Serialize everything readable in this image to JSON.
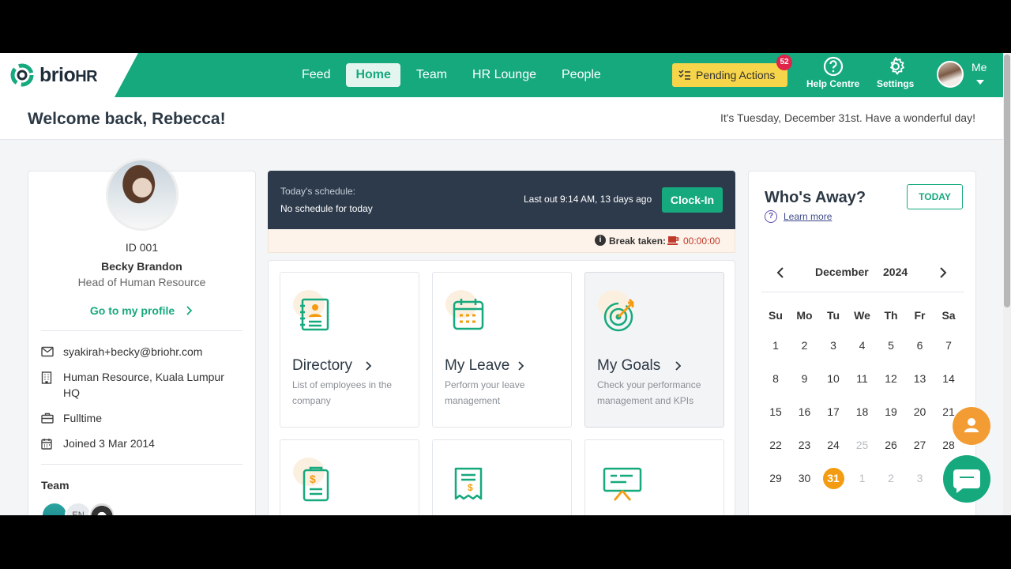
{
  "brand": {
    "name_main": "brio",
    "name_suffix": "HR"
  },
  "nav": {
    "items": [
      "Feed",
      "Home",
      "Team",
      "HR Lounge",
      "People"
    ],
    "active": "Home"
  },
  "header_actions": {
    "pending_label": "Pending Actions",
    "pending_count": "52",
    "help_label": "Help Centre",
    "settings_label": "Settings",
    "me_label": "Me"
  },
  "welcome": {
    "title": "Welcome back, Rebecca!",
    "date_message": "It's Tuesday, December 31st. Have a wonderful day!"
  },
  "profile": {
    "id": "ID 001",
    "name": "Becky Brandon",
    "role": "Head of Human Resource",
    "profile_link": "Go to my profile",
    "email": "syakirah+becky@briohr.com",
    "department": "Human Resource, Kuala Lumpur HQ",
    "employment": "Fulltime",
    "joined": "Joined 3 Mar 2014",
    "team_label": "Team",
    "team_avatar_initials": "EN"
  },
  "schedule": {
    "label": "Today's schedule:",
    "value": "No schedule for today",
    "last_out": "Last out 9:14 AM, 13 days ago",
    "clock_in": "Clock-In",
    "break_label": "Break taken:",
    "break_timer": "00:00:00"
  },
  "tiles": [
    {
      "title": "Directory",
      "desc": "List of employees in the company"
    },
    {
      "title": "My Leave",
      "desc": "Perform your leave management"
    },
    {
      "title": "My Goals",
      "desc": "Check your performance management and KPIs"
    }
  ],
  "away": {
    "title": "Who's Away?",
    "today_btn": "TODAY",
    "learn_more": "Learn more",
    "month": "December",
    "year": "2024",
    "weekdays": [
      "Su",
      "Mo",
      "Tu",
      "We",
      "Th",
      "Fr",
      "Sa"
    ],
    "weeks": [
      [
        "1",
        "2",
        "3",
        "4",
        "5",
        "6",
        "7"
      ],
      [
        "8",
        "9",
        "10",
        "11",
        "12",
        "13",
        "14"
      ],
      [
        "15",
        "16",
        "17",
        "18",
        "19",
        "20",
        "21"
      ],
      [
        "22",
        "23",
        "24",
        "25",
        "26",
        "27",
        "28"
      ],
      [
        "29",
        "30",
        "31",
        "1",
        "2",
        "3",
        ""
      ]
    ],
    "today_day": "31",
    "muted_day": "25"
  },
  "colors": {
    "primary": "#16a97e",
    "pending": "#f7d54a",
    "badge": "#e0244a",
    "today": "#f39c12",
    "schedule_bg": "#2d3a4b"
  }
}
